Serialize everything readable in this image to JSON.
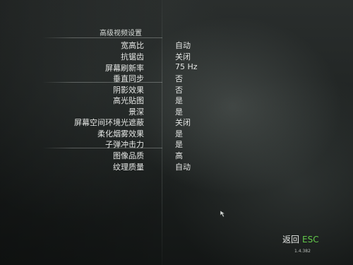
{
  "menu": {
    "title": "高级视频设置",
    "settings": [
      {
        "label": "宽高比",
        "value": "自动"
      },
      {
        "label": "抗锯齿",
        "value": "关闭"
      },
      {
        "label": "屏幕刷新率",
        "value": "75 Hz"
      },
      {
        "label": "垂直同步",
        "value": "否"
      },
      {
        "label": "阴影效果",
        "value": "否"
      },
      {
        "label": "高光贴图",
        "value": "是"
      },
      {
        "label": "景深",
        "value": "是"
      },
      {
        "label": "屏幕空间环境光遮蔽",
        "value": "关闭"
      },
      {
        "label": "柔化烟雾效果",
        "value": "是"
      },
      {
        "label": "子弹冲击力",
        "value": "是"
      },
      {
        "label": "图像品质",
        "value": "高"
      },
      {
        "label": "纹理质量",
        "value": "自动"
      }
    ]
  },
  "footer": {
    "back_label": "返回",
    "back_key": "ESC",
    "version": "1.4.382"
  },
  "colors": {
    "accent_green": "#62c84a",
    "text": "#e4e6e4"
  },
  "icons": {
    "cursor": "mouse-pointer-icon"
  }
}
